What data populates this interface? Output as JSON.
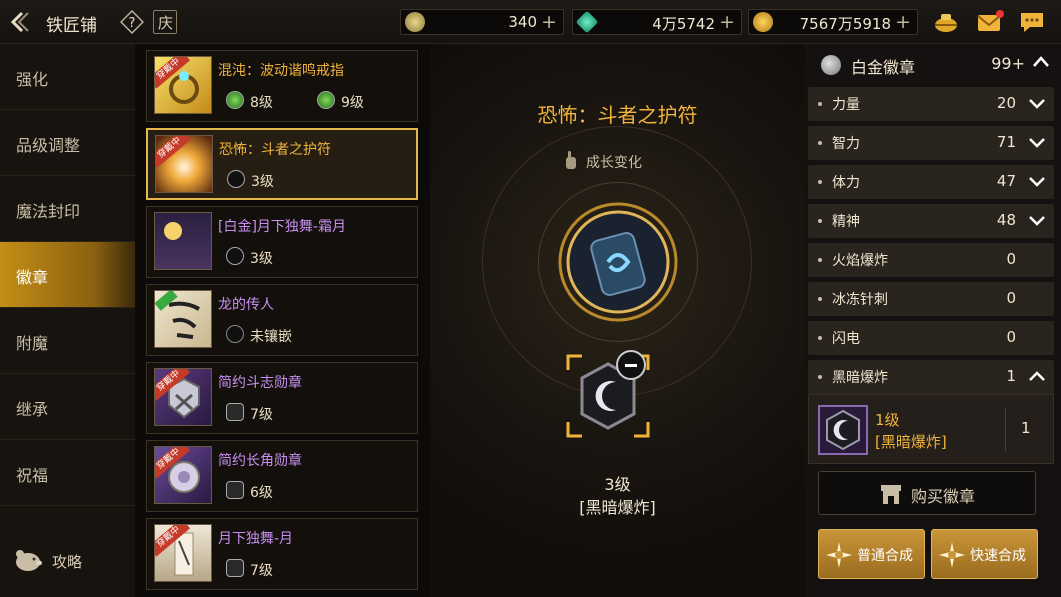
{
  "header": {
    "title": "铁匠铺",
    "calendar_glyph": "庆",
    "currencies": [
      {
        "name": "crystal-icon",
        "value": "340",
        "color": "#d9c27a"
      },
      {
        "name": "gem-icon",
        "value": "4万5742",
        "color": "#35c7a0"
      },
      {
        "name": "gold-coin-icon",
        "value": "7567万5918",
        "color": "#e0a82a"
      }
    ]
  },
  "leftmenu": {
    "items": [
      {
        "label": "强化"
      },
      {
        "label": "品级调整"
      },
      {
        "label": "魔法封印"
      },
      {
        "label": "徽章"
      },
      {
        "label": "附魔"
      },
      {
        "label": "继承"
      },
      {
        "label": "祝福"
      }
    ],
    "active_index": 3,
    "guide_label": "攻略"
  },
  "items": [
    {
      "name": "混沌：波动谐鸣戒指",
      "color": "gold",
      "ribbon": "穿戴中",
      "slots": [
        {
          "icon": "green-emblem-icon",
          "text": "8级"
        },
        {
          "icon": "green-emblem-icon",
          "text": "9级"
        }
      ]
    },
    {
      "name": "恐怖：斗者之护符",
      "color": "gold",
      "ribbon": "穿戴中",
      "slots": [
        {
          "icon": "crescent-emblem-icon",
          "text": "3级"
        }
      ]
    },
    {
      "name": "[白金]月下独舞-霜月",
      "color": "purple",
      "ribbon": "",
      "slots": [
        {
          "icon": "crescent-emblem-icon",
          "text": "3级"
        }
      ]
    },
    {
      "name": "龙的传人",
      "color": "purple",
      "ribbon": "",
      "slots": [
        {
          "icon": "empty-slot-icon",
          "text": "未镶嵌"
        }
      ]
    },
    {
      "name": "简约斗志勋章",
      "color": "purple",
      "ribbon": "穿戴中",
      "slots": [
        {
          "icon": "shield-emblem-icon",
          "text": "7级"
        }
      ]
    },
    {
      "name": "简约长角勋章",
      "color": "purple",
      "ribbon": "穿戴中",
      "slots": [
        {
          "icon": "shield-emblem-icon",
          "text": "6级"
        }
      ]
    },
    {
      "name": "月下独舞-月",
      "color": "purple",
      "ribbon": "穿戴中",
      "slots": [
        {
          "icon": "shield-emblem-icon",
          "text": "7级"
        }
      ]
    }
  ],
  "center": {
    "title": "恐怖：斗者之护符",
    "growth_label": "成长变化",
    "emblem_level": "3级",
    "emblem_name": "[黑暗爆炸]"
  },
  "right": {
    "platinum_label": "白金徽章",
    "platinum_count": "99+",
    "stats": [
      {
        "label": "力量",
        "value": "20",
        "arrow": "down"
      },
      {
        "label": "智力",
        "value": "71",
        "arrow": "down"
      },
      {
        "label": "体力",
        "value": "47",
        "arrow": "down"
      },
      {
        "label": "精神",
        "value": "48",
        "arrow": "down"
      },
      {
        "label": "火焰爆炸",
        "value": "0",
        "arrow": ""
      },
      {
        "label": "冰冻针刺",
        "value": "0",
        "arrow": ""
      },
      {
        "label": "闪电",
        "value": "0",
        "arrow": ""
      },
      {
        "label": "黑暗爆炸",
        "value": "1",
        "arrow": "up"
      }
    ],
    "gem": {
      "level": "1级",
      "name": "[黑暗爆炸]",
      "count": "1"
    },
    "buy_label": "购买徽章",
    "normal_synth_label": "普通合成",
    "fast_synth_label": "快速合成"
  }
}
